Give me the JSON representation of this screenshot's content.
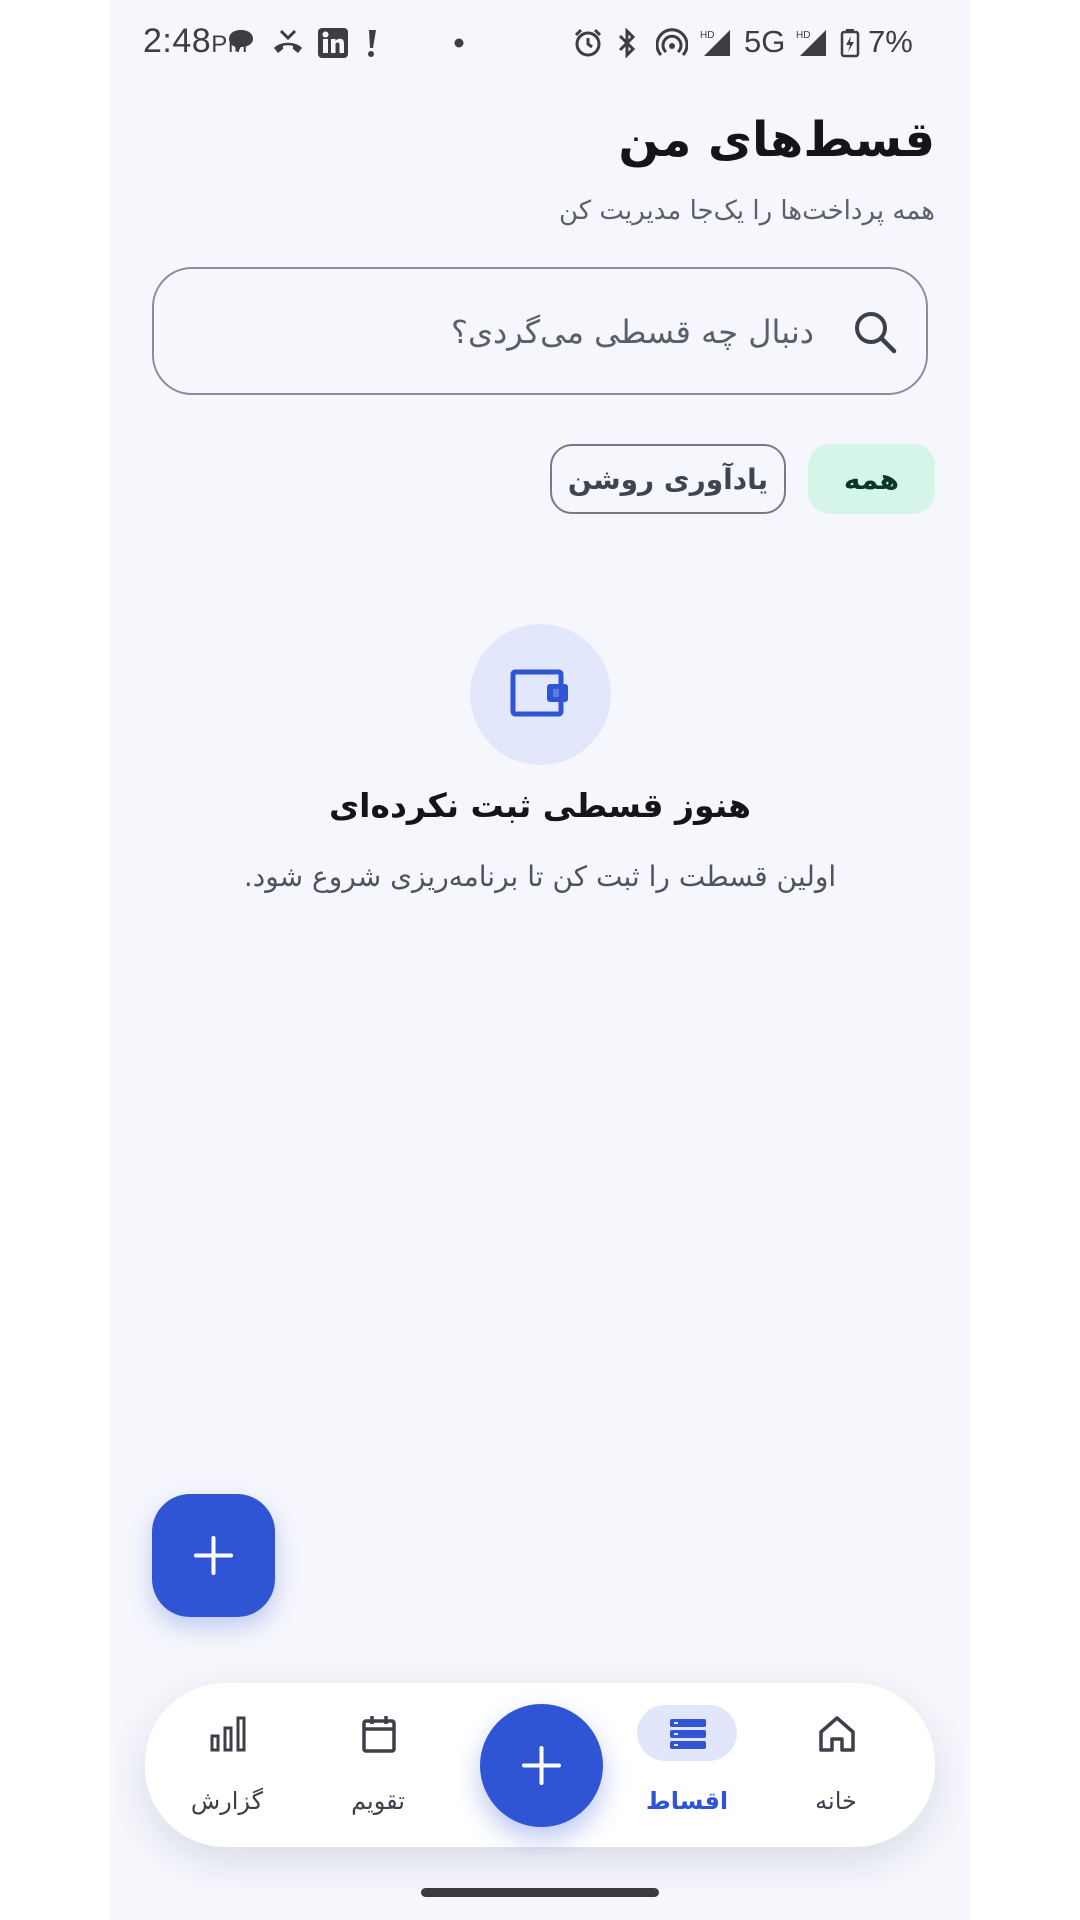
{
  "status_bar": {
    "time": "2:48",
    "ampm": "PM",
    "network": "5G",
    "battery": "7%"
  },
  "header": {
    "title": "قسط‌های من",
    "subtitle": "همه پرداخت‌ها را یک‌جا مدیریت کن"
  },
  "search": {
    "placeholder": "دنبال چه قسطی می‌گردی؟",
    "value": ""
  },
  "filters": {
    "all_label": "همه",
    "reminder_label": "یادآوری روشن",
    "selected": "همه"
  },
  "empty_state": {
    "title": "هنوز قسطی ثبت نکرده‌ای",
    "description": "اولین قسطت را ثبت کن تا برنامه‌ریزی شروع شود."
  },
  "bottom_nav": {
    "home_label": "خانه",
    "installments_label": "اقساط",
    "calendar_label": "تقویم",
    "report_label": "گزارش",
    "active": "اقساط"
  },
  "colors": {
    "accent": "#2f55d4",
    "background": "#f6f7fc",
    "chip_active_bg": "#d5f5e8",
    "empty_icon_bg": "#e3e7fb"
  },
  "icons": {
    "search": "search-icon",
    "wallet": "wallet-icon",
    "add": "plus-icon",
    "home": "home-icon",
    "installments": "list-icon",
    "calendar": "calendar-icon",
    "report": "bar-chart-icon"
  }
}
